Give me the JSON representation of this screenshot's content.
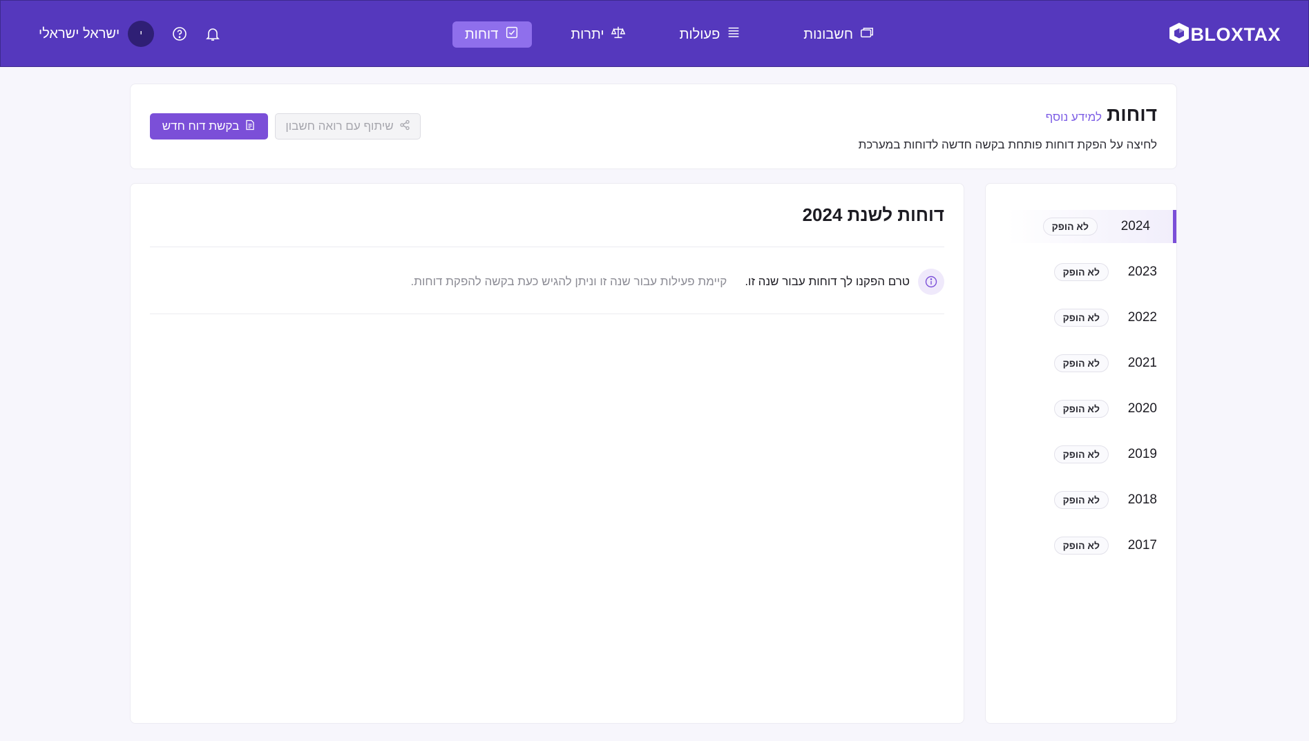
{
  "brand": {
    "name": "BLOXTAX"
  },
  "nav": {
    "accounts": "חשבונות",
    "actions": "פעולות",
    "balances": "יתרות",
    "reports": "דוחות"
  },
  "user": {
    "initial": "י",
    "name": "ישראל ישראלי"
  },
  "header": {
    "title": "דוחות",
    "more_info": "למידע נוסף",
    "subtitle": "לחיצה על הפקת דוחות פותחת בקשה חדשה לדוחות במערכת",
    "new_report_button": "בקשת דוח חדש",
    "share_button": "שיתוף עם רואה חשבון"
  },
  "years": [
    {
      "year": "2024",
      "status": "לא הופק",
      "active": true
    },
    {
      "year": "2023",
      "status": "לא הופק"
    },
    {
      "year": "2022",
      "status": "לא הופק"
    },
    {
      "year": "2021",
      "status": "לא הופק"
    },
    {
      "year": "2020",
      "status": "לא הופק"
    },
    {
      "year": "2019",
      "status": "לא הופק"
    },
    {
      "year": "2018",
      "status": "לא הופק"
    },
    {
      "year": "2017",
      "status": "לא הופק"
    }
  ],
  "main": {
    "section_title": "דוחות לשנת 2024",
    "info_strong": "טרם הפקנו לך דוחות עבור שנה זו.",
    "info_muted": "קיימת פעילות עבור שנה זו וניתן להגיש כעת בקשה להפקת דוחות."
  },
  "colors": {
    "primary": "#5538bd",
    "accent": "#7b4fd8",
    "active_nav": "#8f6fec"
  },
  "icons": [
    "cube-logo-icon",
    "folders-icon",
    "list-icon",
    "scale-icon",
    "report-icon",
    "bell-icon",
    "help-icon",
    "share-icon",
    "document-icon",
    "info-icon"
  ]
}
